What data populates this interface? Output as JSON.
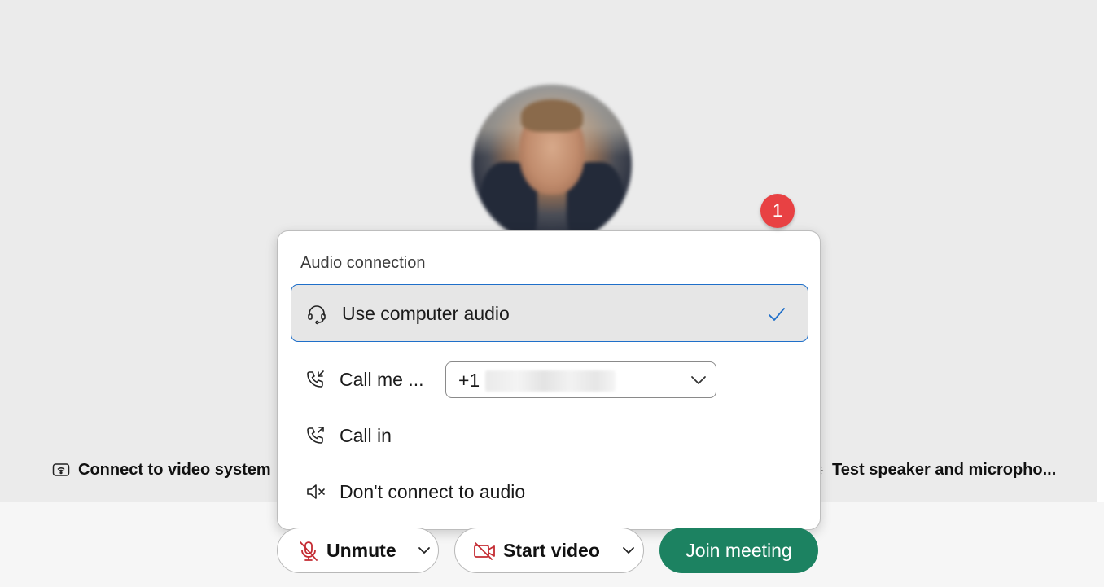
{
  "side_links": {
    "left_label": "Connect to video system",
    "right_label": "Test speaker and micropho..."
  },
  "badge": {
    "number": "1"
  },
  "audio_popup": {
    "heading": "Audio connection",
    "options": [
      {
        "label": "Use computer audio",
        "icon": "headset-icon",
        "selected": true
      },
      {
        "label": "Call me ...",
        "icon": "phone-incoming-icon"
      },
      {
        "label": "Call in",
        "icon": "phone-outgoing-icon"
      },
      {
        "label": "Don't connect to audio",
        "icon": "speaker-off-icon"
      }
    ],
    "phone": {
      "prefix": "+1"
    }
  },
  "controls": {
    "unmute_label": "Unmute",
    "start_video_label": "Start video",
    "join_label": "Join meeting"
  },
  "colors": {
    "selection_border": "#1f6fc9",
    "join_button": "#1c8261",
    "badge": "#e84143",
    "muted_red": "#c42b32"
  }
}
